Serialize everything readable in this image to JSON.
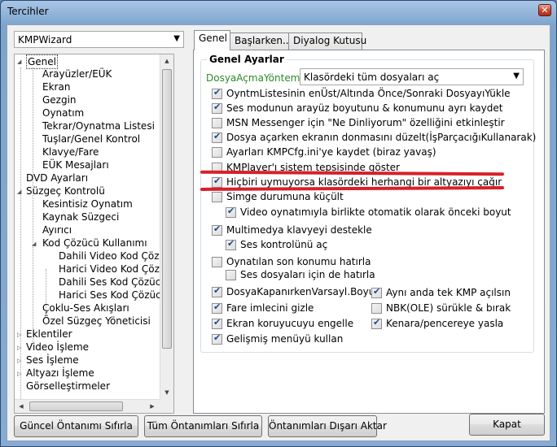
{
  "window": {
    "title": "Tercihler",
    "close_label": "✕"
  },
  "preset": {
    "value": "KMPWizard"
  },
  "tree": {
    "items": [
      {
        "label": "Genel"
      },
      {
        "label": "Arayüzler/EÜK"
      },
      {
        "label": "Ekran"
      },
      {
        "label": "Gezgin"
      },
      {
        "label": "Oynatım"
      },
      {
        "label": "Tekrar/Oynatma Listesi"
      },
      {
        "label": "Tuşlar/Genel Kontrol"
      },
      {
        "label": "Klavye/Fare"
      },
      {
        "label": "EÜK Mesajları"
      },
      {
        "label": "DVD Ayarları"
      },
      {
        "label": "Süzgeç Kontrolü"
      },
      {
        "label": "Kesintisiz Oynatım"
      },
      {
        "label": "Kaynak Süzgeci"
      },
      {
        "label": "Ayırıcı"
      },
      {
        "label": "Kod Çözücü Kullanımı"
      },
      {
        "label": "Dahili Video Kod Çözücü"
      },
      {
        "label": "Harici Video Kod Çözücü"
      },
      {
        "label": "Dahili Ses Kod Çözücü"
      },
      {
        "label": "Harici Ses Kod Çözücü"
      },
      {
        "label": "Çoklu-Ses Akışları"
      },
      {
        "label": "Özel Süzgeç Yöneticisi"
      },
      {
        "label": "Eklentiler"
      },
      {
        "label": "Video İşleme"
      },
      {
        "label": "Ses İşleme"
      },
      {
        "label": "Altyazı İşleme"
      },
      {
        "label": "Görselleştirmeler"
      }
    ]
  },
  "tabs": {
    "general": "Genel",
    "startup": "Başlarken...",
    "dialog": "Diyalog Kutusu"
  },
  "group": {
    "title": "Genel Ayarlar",
    "open_mode_label": "DosyaAçmaYöntemi:",
    "open_mode_value": "Klasördeki tüm dosyaları aç"
  },
  "options": [
    {
      "label": "OyntmListesinin enÜst/Altında Önce/Sonraki DosyayıYükle",
      "checked": true
    },
    {
      "label": "Ses modunun arayüz boyutunu & konumunu ayrı kaydet",
      "checked": true
    },
    {
      "label": "MSN Messenger için \"Ne Dinliyorum\" özelliğini etkinleştir",
      "checked": false
    },
    {
      "label": "Dosya açarken ekranın donmasını düzelt(İşParçacığıKullanarak)",
      "checked": true
    },
    {
      "label": "Ayarları KMPCfg.ini'ye kaydet (biraz yavaş)",
      "checked": false
    },
    {
      "label": "KMPlayer'ı sistem tepsisinde göster",
      "checked": false
    },
    {
      "label": "Hiçbiri uymuyorsa klasördeki herhangi bir altyazıyı çağır",
      "checked": true
    },
    {
      "label": "Simge durumuna küçült",
      "checked": false
    },
    {
      "label": "Video oynatımıyla birlikte otomatik olarak önceki boyut",
      "checked": true
    },
    {
      "label": "Multimedya klavyeyi destekle",
      "checked": true
    },
    {
      "label": "Ses kontrolünü aç",
      "checked": true
    },
    {
      "label": "Oynatılan son konumu hatırla",
      "checked": false
    },
    {
      "label": "Ses dosyaları için de hatırla",
      "checked": false
    },
    {
      "label": "DosyaKapanırkenVarsayl.Boyut",
      "checked": true
    },
    {
      "label": "Aynı anda tek KMP açılsın",
      "checked": true
    },
    {
      "label": "Fare imlecini gizle",
      "checked": true
    },
    {
      "label": "NBK(OLE) sürükle & bırak",
      "checked": false
    },
    {
      "label": "Ekran koruyucuyu engelle",
      "checked": true
    },
    {
      "label": "Kenara/pencereye yasla",
      "checked": true
    },
    {
      "label": "Gelişmiş menüyü kullan",
      "checked": true
    }
  ],
  "buttons": {
    "reset_current": "Güncel Öntanımı Sıfırla",
    "reset_all": "Tüm Öntanımları Sıfırla",
    "export": "Öntanımları Dışarı Aktar",
    "close": "Kapat"
  }
}
